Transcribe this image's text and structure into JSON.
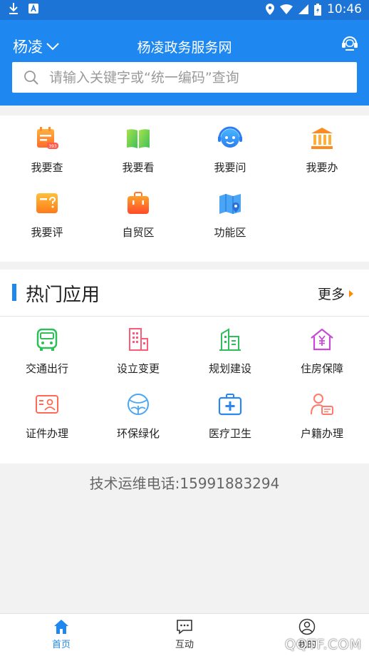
{
  "status_bar": {
    "time": "10:46"
  },
  "header": {
    "city": "杨凌",
    "title": "杨凌政务服务网",
    "search_placeholder": "请输入关键字或“统一编码”查询"
  },
  "quick_menu": [
    {
      "label": "我要查",
      "icon": "calendar-search-icon"
    },
    {
      "label": "我要看",
      "icon": "book-icon"
    },
    {
      "label": "我要问",
      "icon": "headset-face-icon"
    },
    {
      "label": "我要办",
      "icon": "government-building-icon"
    },
    {
      "label": "我要评",
      "icon": "review-question-icon"
    },
    {
      "label": "自贸区",
      "icon": "briefcase-icon"
    },
    {
      "label": "功能区",
      "icon": "map-pin-icon"
    }
  ],
  "hot_apps": {
    "title": "热门应用",
    "more": "更多",
    "items": [
      {
        "label": "交通出行",
        "icon": "bus-icon"
      },
      {
        "label": "设立变更",
        "icon": "office-building-icon"
      },
      {
        "label": "规划建设",
        "icon": "city-buildings-icon"
      },
      {
        "label": "住房保障",
        "icon": "house-yuan-icon"
      },
      {
        "label": "证件办理",
        "icon": "id-card-icon"
      },
      {
        "label": "环保绿化",
        "icon": "leaf-globe-icon"
      },
      {
        "label": "医疗卫生",
        "icon": "medical-kit-icon"
      },
      {
        "label": "户籍办理",
        "icon": "person-card-icon"
      }
    ]
  },
  "hotline": "技术运维电话:15991883294",
  "tabbar": [
    {
      "label": "首页",
      "icon": "home-icon",
      "active": true
    },
    {
      "label": "互动",
      "icon": "chat-icon",
      "active": false
    },
    {
      "label": "我的",
      "icon": "user-icon",
      "active": false
    }
  ],
  "watermark": "QQTF.COM",
  "colors": {
    "primary": "#1e88f0",
    "status_bar": "#1b74d6",
    "accent": "#ff8a00"
  }
}
